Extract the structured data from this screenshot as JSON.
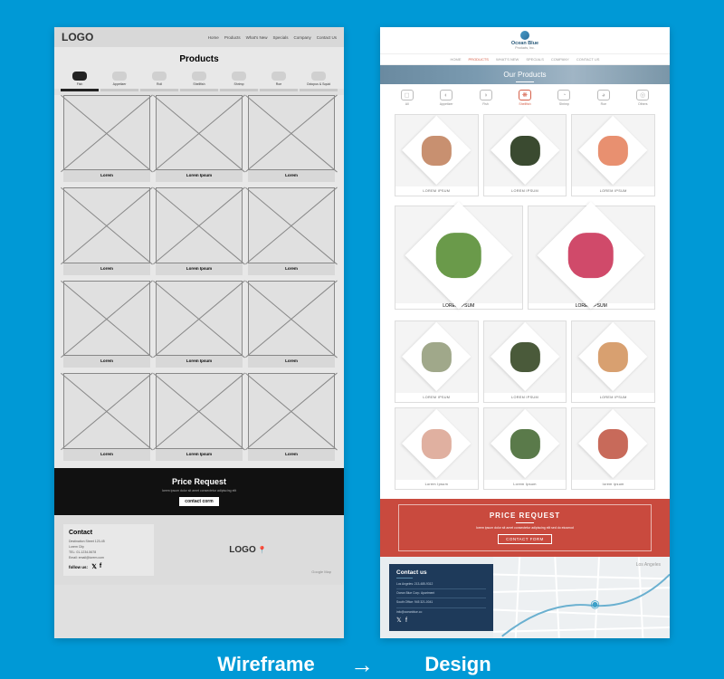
{
  "labels": {
    "left": "Wireframe",
    "right": "Design",
    "arrow": "→"
  },
  "wireframe": {
    "logo": "LOGO",
    "nav": [
      "Home",
      "Products",
      "What's New",
      "Specials",
      "Company",
      "Contact Us"
    ],
    "title": "Products",
    "categories": [
      "Fish",
      "Appetizer",
      "Roll",
      "Shellfish",
      "Shrimp",
      "Roe",
      "Octopus & Squid"
    ],
    "activeCategory": 0,
    "cards": [
      "Lorem",
      "Lorem Ipsum",
      "Lorem",
      "Lorem",
      "Lorem Ipsum",
      "Lorem",
      "Lorem",
      "Lorem Ipsum",
      "Lorem",
      "Lorem",
      "Lorem Ipsum",
      "Lorem"
    ],
    "priceRequest": {
      "title": "Price Request",
      "sub": "lorem ipsum dolor sit amet consectetur adipiscing elit",
      "button": "contact corm"
    },
    "contact": {
      "title": "Contact",
      "lines": [
        "Destination Street 123-45",
        "Lorem City",
        "TEL: 01-1234-5678",
        "Email: email@lorem.com"
      ],
      "follow": "follow us:",
      "mapLogo": "LOGO",
      "mapLabel": "Google Map"
    }
  },
  "design": {
    "brand": "Ocean Blue",
    "brandSub": "Products, Inc.",
    "nav": [
      "HOME",
      "PRODUCTS",
      "WHAT'S NEW",
      "SPECIALS",
      "COMPANY",
      "CONTACT US"
    ],
    "activeNav": 1,
    "hero": "Our Products",
    "categories": [
      "All",
      "Appetizer",
      "Fish",
      "Shellfish",
      "Shrimp",
      "Roe",
      "Others"
    ],
    "activeCategory": 3,
    "cards": [
      {
        "label": "LOREM IPSUM",
        "color": "#c89070"
      },
      {
        "label": "LOREM IPSUM",
        "color": "#3a4a30"
      },
      {
        "label": "LOREM IPSUM",
        "color": "#e89070"
      }
    ],
    "bigCards": [
      {
        "label": "LOREM IPSUM",
        "color": "#6a9a4a"
      },
      {
        "label": "LOREM IPSUM",
        "color": "#d04a6a"
      }
    ],
    "cards2": [
      {
        "label": "LOREM IPSUM",
        "color": "#a0a88a"
      },
      {
        "label": "LOREM IPSUM",
        "color": "#4a5a3a"
      },
      {
        "label": "LOREM IPSUM",
        "color": "#d8a070"
      },
      {
        "label": "Lorem Ipsum",
        "color": "#e0b0a0"
      },
      {
        "label": "Lorem Ipsum",
        "color": "#5a7a4a"
      },
      {
        "label": "lorem ipsum",
        "color": "#c86a5a"
      }
    ],
    "priceRequest": {
      "title": "PRICE REQUEST",
      "sub": "lorem ipsum dolor sit amet consectetur adipiscing elit sed do eiusmod",
      "button": "CONTACT FORM"
    },
    "contact": {
      "title": "Contact us",
      "lines": [
        "Los Angeles: 213-485-9312",
        "Ocean Blue Corp. Apartment",
        "South Office: 945 321-0041",
        "info@oceanblue.co"
      ],
      "mapLabel": "Los Angeles"
    }
  }
}
